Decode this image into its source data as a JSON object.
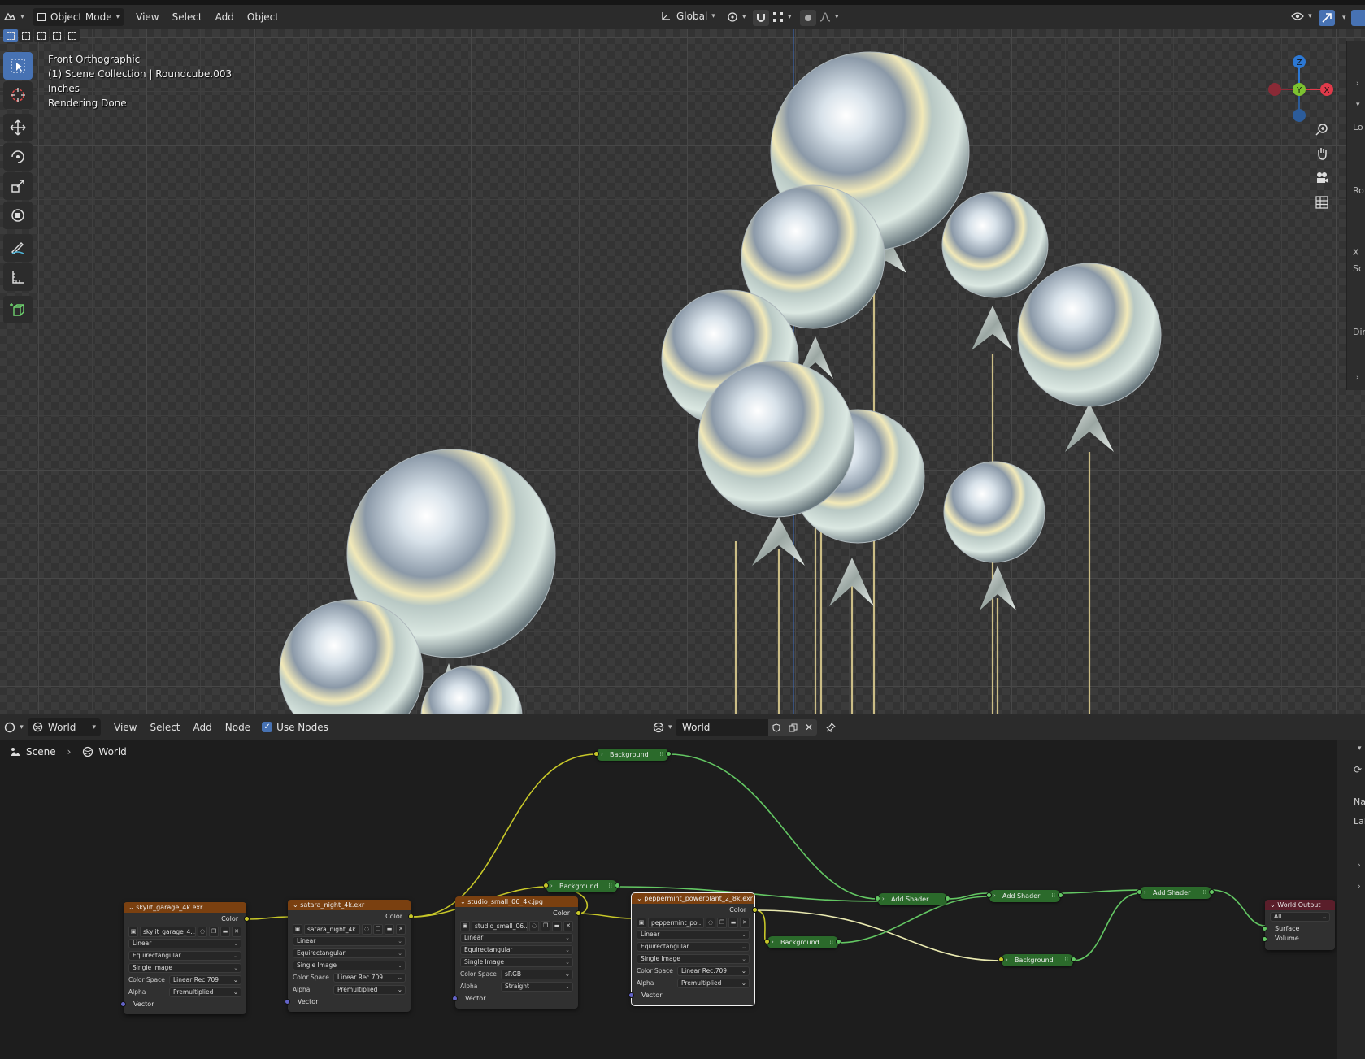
{
  "top_header": {
    "mode_label": "Object Mode",
    "menus": [
      "View",
      "Select",
      "Add",
      "Object"
    ],
    "transform_orientation": "Global"
  },
  "viewport": {
    "overlay": {
      "view_name": "Front Orthographic",
      "collection": "(1) Scene Collection | Roundcube.003",
      "units": "Inches",
      "status": "Rendering Done"
    },
    "gizmo_axes": [
      "Z",
      "Y",
      "X"
    ],
    "npanel_labels": [
      "Lo",
      "Ro",
      "X",
      "Sc",
      "Dir"
    ]
  },
  "node_header": {
    "editor_type": "World",
    "menus": [
      "View",
      "Select",
      "Add",
      "Node"
    ],
    "use_nodes_label": "Use Nodes",
    "use_nodes_checked": true,
    "datablock_name": "World"
  },
  "breadcrumb": {
    "scene": "Scene",
    "world": "World"
  },
  "node_sidebar_labels": [
    "Na",
    "Lab"
  ],
  "env_nodes": [
    {
      "title": "skylit_garage_4k.exr",
      "output": "Color",
      "image_name": "skylit_garage_4...",
      "interpolation": "Linear",
      "projection": "Equirectangular",
      "source": "Single Image",
      "color_space_label": "Color Space",
      "color_space": "Linear Rec.709",
      "alpha_label": "Alpha",
      "alpha": "Premultiplied",
      "input": "Vector"
    },
    {
      "title": "satara_night_4k.exr",
      "output": "Color",
      "image_name": "satara_night_4k...",
      "interpolation": "Linear",
      "projection": "Equirectangular",
      "source": "Single Image",
      "color_space_label": "Color Space",
      "color_space": "Linear Rec.709",
      "alpha_label": "Alpha",
      "alpha": "Premultiplied",
      "input": "Vector"
    },
    {
      "title": "studio_small_06_4k.jpg",
      "output": "Color",
      "image_name": "studio_small_06...",
      "interpolation": "Linear",
      "projection": "Equirectangular",
      "source": "Single Image",
      "color_space_label": "Color Space",
      "color_space": "sRGB",
      "alpha_label": "Alpha",
      "alpha": "Straight",
      "input": "Vector"
    },
    {
      "title": "peppermint_powerplant_2_8k.exr",
      "output": "Color",
      "image_name": "peppermint_po...",
      "interpolation": "Linear",
      "projection": "Equirectangular",
      "source": "Single Image",
      "color_space_label": "Color Space",
      "color_space": "Linear Rec.709",
      "alpha_label": "Alpha",
      "alpha": "Premultiplied",
      "input": "Vector"
    }
  ],
  "collapsed_nodes": {
    "background_1": "Background",
    "background_2": "Background",
    "background_3": "Background",
    "background_4": "Background",
    "add_shader_1": "Add Shader",
    "add_shader_2": "Add Shader",
    "add_shader_3": "Add Shader"
  },
  "world_output": {
    "title": "World Output",
    "target": "All",
    "surface": "Surface",
    "volume": "Volume"
  },
  "colors": {
    "accent": "#4772b3",
    "texture_header": "#7a4010",
    "shader_node": "#2b6a2b",
    "output_header": "#5a1e2a",
    "socket_color": "#c7c729",
    "socket_shader": "#63c763",
    "socket_vector": "#6363c7"
  }
}
